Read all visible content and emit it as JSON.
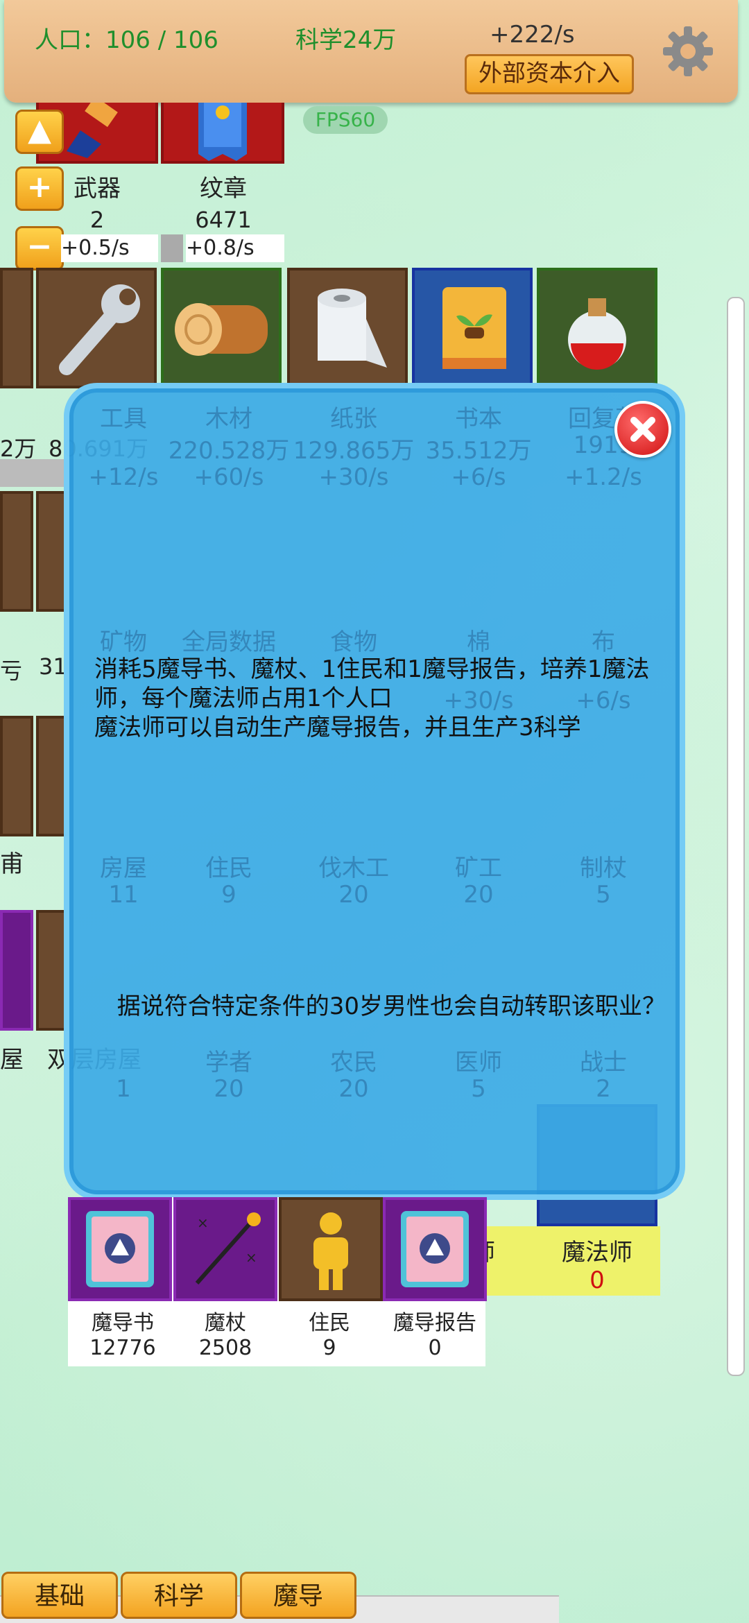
{
  "top": {
    "population": "人口：106 / 106",
    "science": "科学24万",
    "rate": "+222/s",
    "external_button": "外部资本介入"
  },
  "fps": "FPS60",
  "side_buttons": [
    "▲",
    "+",
    "−"
  ],
  "resources_row1": [
    {
      "name": "武器",
      "value": "2",
      "rate": "+0.5/s",
      "icon": "brush-icon"
    },
    {
      "name": "纹章",
      "value": "6471",
      "rate": "+0.8/s",
      "icon": "banner-icon"
    }
  ],
  "background_grid": {
    "row2": [
      {
        "name": "工具",
        "value": "80.691万",
        "rate": "+12/s",
        "icon": "wrench-icon"
      },
      {
        "name": "木材",
        "value": "220.528万",
        "rate": "+60/s",
        "icon": "log-icon"
      },
      {
        "name": "纸张",
        "value": "129.865万",
        "rate": "+30/s",
        "icon": "paper-roll-icon"
      },
      {
        "name": "书本",
        "value": "35.512万",
        "rate": "+6/s",
        "icon": "book-icon"
      },
      {
        "name": "回复药",
        "value": "1919",
        "rate": "+1.2/s",
        "icon": "potion-icon"
      }
    ],
    "row2_left_partial": "2万",
    "row3": [
      {
        "name": "矿物",
        "icon": "ore-icon"
      },
      {
        "name": "全局数据",
        "icon": "globe-icon"
      },
      {
        "name": "食物",
        "icon": "apple-icon"
      },
      {
        "name": "棉",
        "icon": "cotton-icon"
      },
      {
        "name": "布",
        "icon": "cloth-icon"
      }
    ],
    "row3_left_partial": "亏",
    "row3_value_partial": "31",
    "row3_rates": [
      "+30/s",
      "+6/s"
    ],
    "row4": [
      {
        "name": "房屋",
        "value": "11",
        "icon": "house-icon"
      },
      {
        "name": "住民",
        "value": "9",
        "icon": "person-icon"
      },
      {
        "name": "伐木工",
        "value": "20",
        "icon": "axe-icon"
      },
      {
        "name": "矿工",
        "value": "20",
        "icon": "pickaxe-icon"
      },
      {
        "name": "制杖",
        "value": "5",
        "icon": "sun-icon"
      }
    ],
    "row4_left_partial": "甫",
    "row5": [
      {
        "name": "双层房屋",
        "value": "1",
        "icon": "house2-icon"
      },
      {
        "name": "学者",
        "value": "20",
        "icon": "scholar-icon"
      },
      {
        "name": "农民",
        "value": "20",
        "icon": "sickle-icon"
      },
      {
        "name": "医师",
        "value": "5",
        "icon": "pill-icon"
      },
      {
        "name": "战士",
        "value": "2",
        "icon": "sword-icon"
      }
    ],
    "row5_left_partial_a": "屋",
    "row5_left_partial_b": "双层房屋",
    "row6_visible_right": [
      {
        "name": "师"
      },
      {
        "name": "魔法师",
        "value": "0"
      }
    ]
  },
  "dialog": {
    "description_line1": "消耗5魔导书、魔杖、1住民和1魔导报告，培养1魔法师，每个魔法师占用1个人口",
    "description_line2": "魔法师可以自动生产魔导报告，并且生产3科学",
    "quote": "据说符合特定条件的30岁男性也会自动转职该职业？"
  },
  "costs": [
    {
      "name": "魔导书",
      "value": "12776",
      "icon": "grimoire-icon"
    },
    {
      "name": "魔杖",
      "value": "2508",
      "icon": "wand-icon"
    },
    {
      "name": "住民",
      "value": "9",
      "icon": "person-icon"
    },
    {
      "name": "魔导报告",
      "value": "0",
      "icon": "grimoire-icon"
    }
  ],
  "tabs": [
    "基础",
    "科学",
    "魔导"
  ],
  "colors": {
    "science_green": "#1f8f2c",
    "dialog_blue": "#3caae6",
    "mage_zero": "#d01010"
  }
}
